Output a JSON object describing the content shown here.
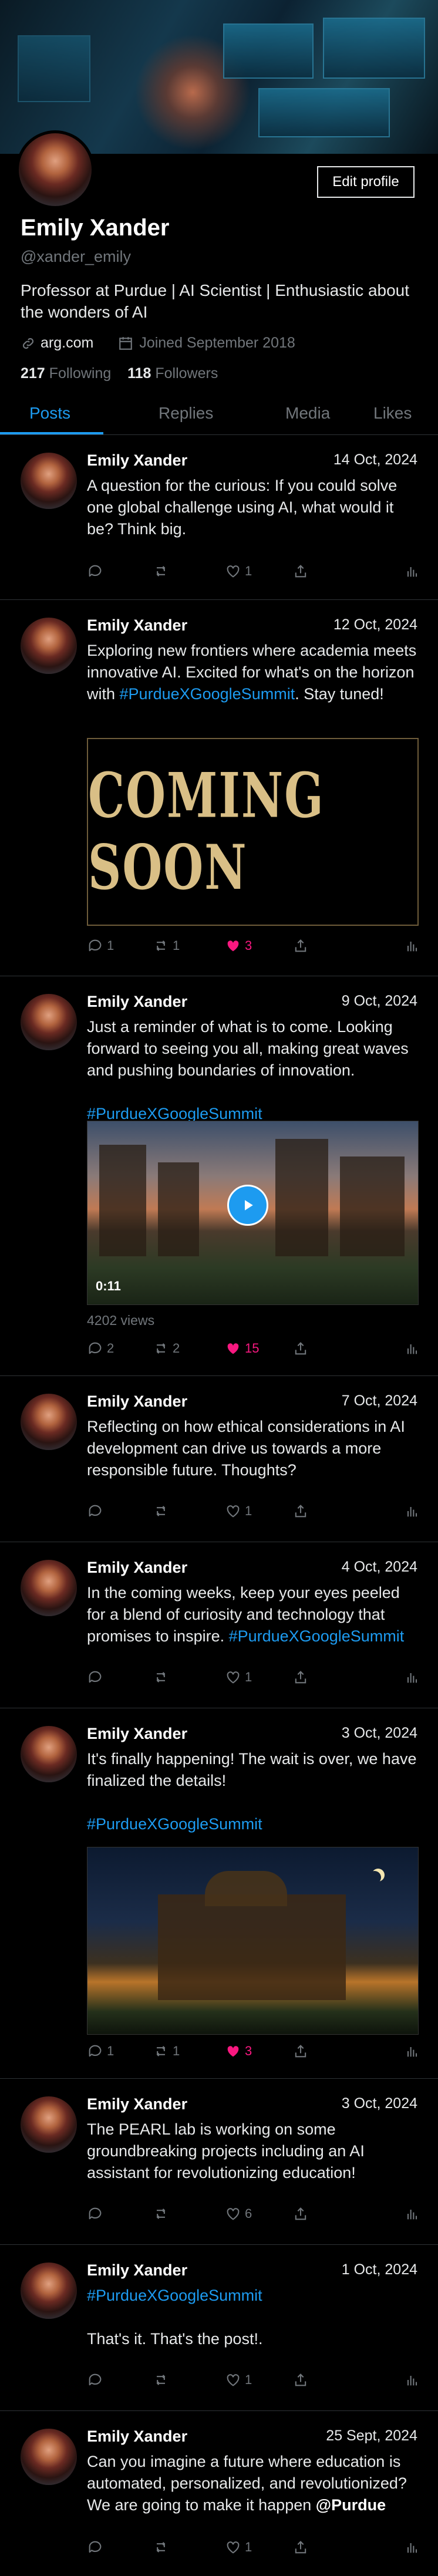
{
  "profile": {
    "name": "Emily Xander",
    "handle": "@xander_emily",
    "edit_label": "Edit profile",
    "bio": "Professor at Purdue | AI Scientist | Enthusiastic about the wonders of AI",
    "website": "arg.com",
    "joined": "Joined September 2018",
    "following_count": "217",
    "following_label": "Following",
    "followers_count": "118",
    "followers_label": "Followers"
  },
  "tabs": [
    "Posts",
    "Replies",
    "Media",
    "Likes"
  ],
  "posts": [
    {
      "name": "Emily Xander",
      "date": "14 Oct, 2024",
      "text": "A question for the curious: If you could solve one global challenge using AI, what would it be? Think big.",
      "replies": "",
      "reposts": "",
      "likes": "1"
    },
    {
      "name": "Emily Xander",
      "date": "12 Oct, 2024",
      "text_pre": "Exploring new frontiers where academia meets innovative AI. Excited for what's on the horizon with ",
      "tag": "#PurdueXGoogleSummit",
      "text_post": ". Stay tuned!",
      "media_text": "COMING SOON",
      "replies": "1",
      "reposts": "1",
      "likes": "3"
    },
    {
      "name": "Emily Xander",
      "date": "9 Oct, 2024",
      "text": "Just a reminder of what is to come. Looking forward to seeing you all, making great waves and pushing boundaries of innovation.",
      "tag": "#PurdueXGoogleSummit",
      "duration": "0:11",
      "views": "4202 views",
      "replies": "2",
      "reposts": "2",
      "likes": "15"
    },
    {
      "name": "Emily Xander",
      "date": "7 Oct, 2024",
      "text": "Reflecting on how ethical considerations in AI development can drive us towards a more responsible future. Thoughts?",
      "replies": "",
      "reposts": "",
      "likes": "1"
    },
    {
      "name": "Emily Xander",
      "date": "4 Oct, 2024",
      "text": "In the coming weeks, keep your eyes peeled for a blend of curiosity and technology that promises to inspire. ",
      "tag": "#PurdueXGoogleSummit",
      "replies": "",
      "reposts": "",
      "likes": "1"
    },
    {
      "name": "Emily Xander",
      "date": "3 Oct, 2024",
      "text": "It's finally happening! The wait is over, we have finalized the details!",
      "tag": "#PurdueXGoogleSummit",
      "replies": "1",
      "reposts": "1",
      "likes": "3"
    },
    {
      "name": "Emily Xander",
      "date": "3 Oct, 2024",
      "text": "The PEARL lab is working on some groundbreaking projects including an AI assistant for revolutionizing education!",
      "replies": "",
      "reposts": "",
      "likes": "6"
    },
    {
      "name": "Emily Xander",
      "date": "1 Oct, 2024",
      "tag": "#PurdueXGoogleSummit",
      "text": "That's it. That's the post!.",
      "replies": "",
      "reposts": "",
      "likes": "1"
    },
    {
      "name": "Emily Xander",
      "date": "25 Sept, 2024",
      "text": "Can you imagine a future where education is automated, personalized, and revolutionized? We are going to make it happen ",
      "mention": "@Purdue",
      "replies": "",
      "reposts": "",
      "likes": "1"
    }
  ],
  "colors": {
    "accent": "#1d9bf0",
    "like": "#f91880",
    "muted": "#71767b",
    "background": "#000000"
  },
  "icons": [
    "link-icon",
    "calendar-icon",
    "reply-icon",
    "repost-icon",
    "like-icon",
    "share-icon",
    "views-icon",
    "play-icon"
  ]
}
